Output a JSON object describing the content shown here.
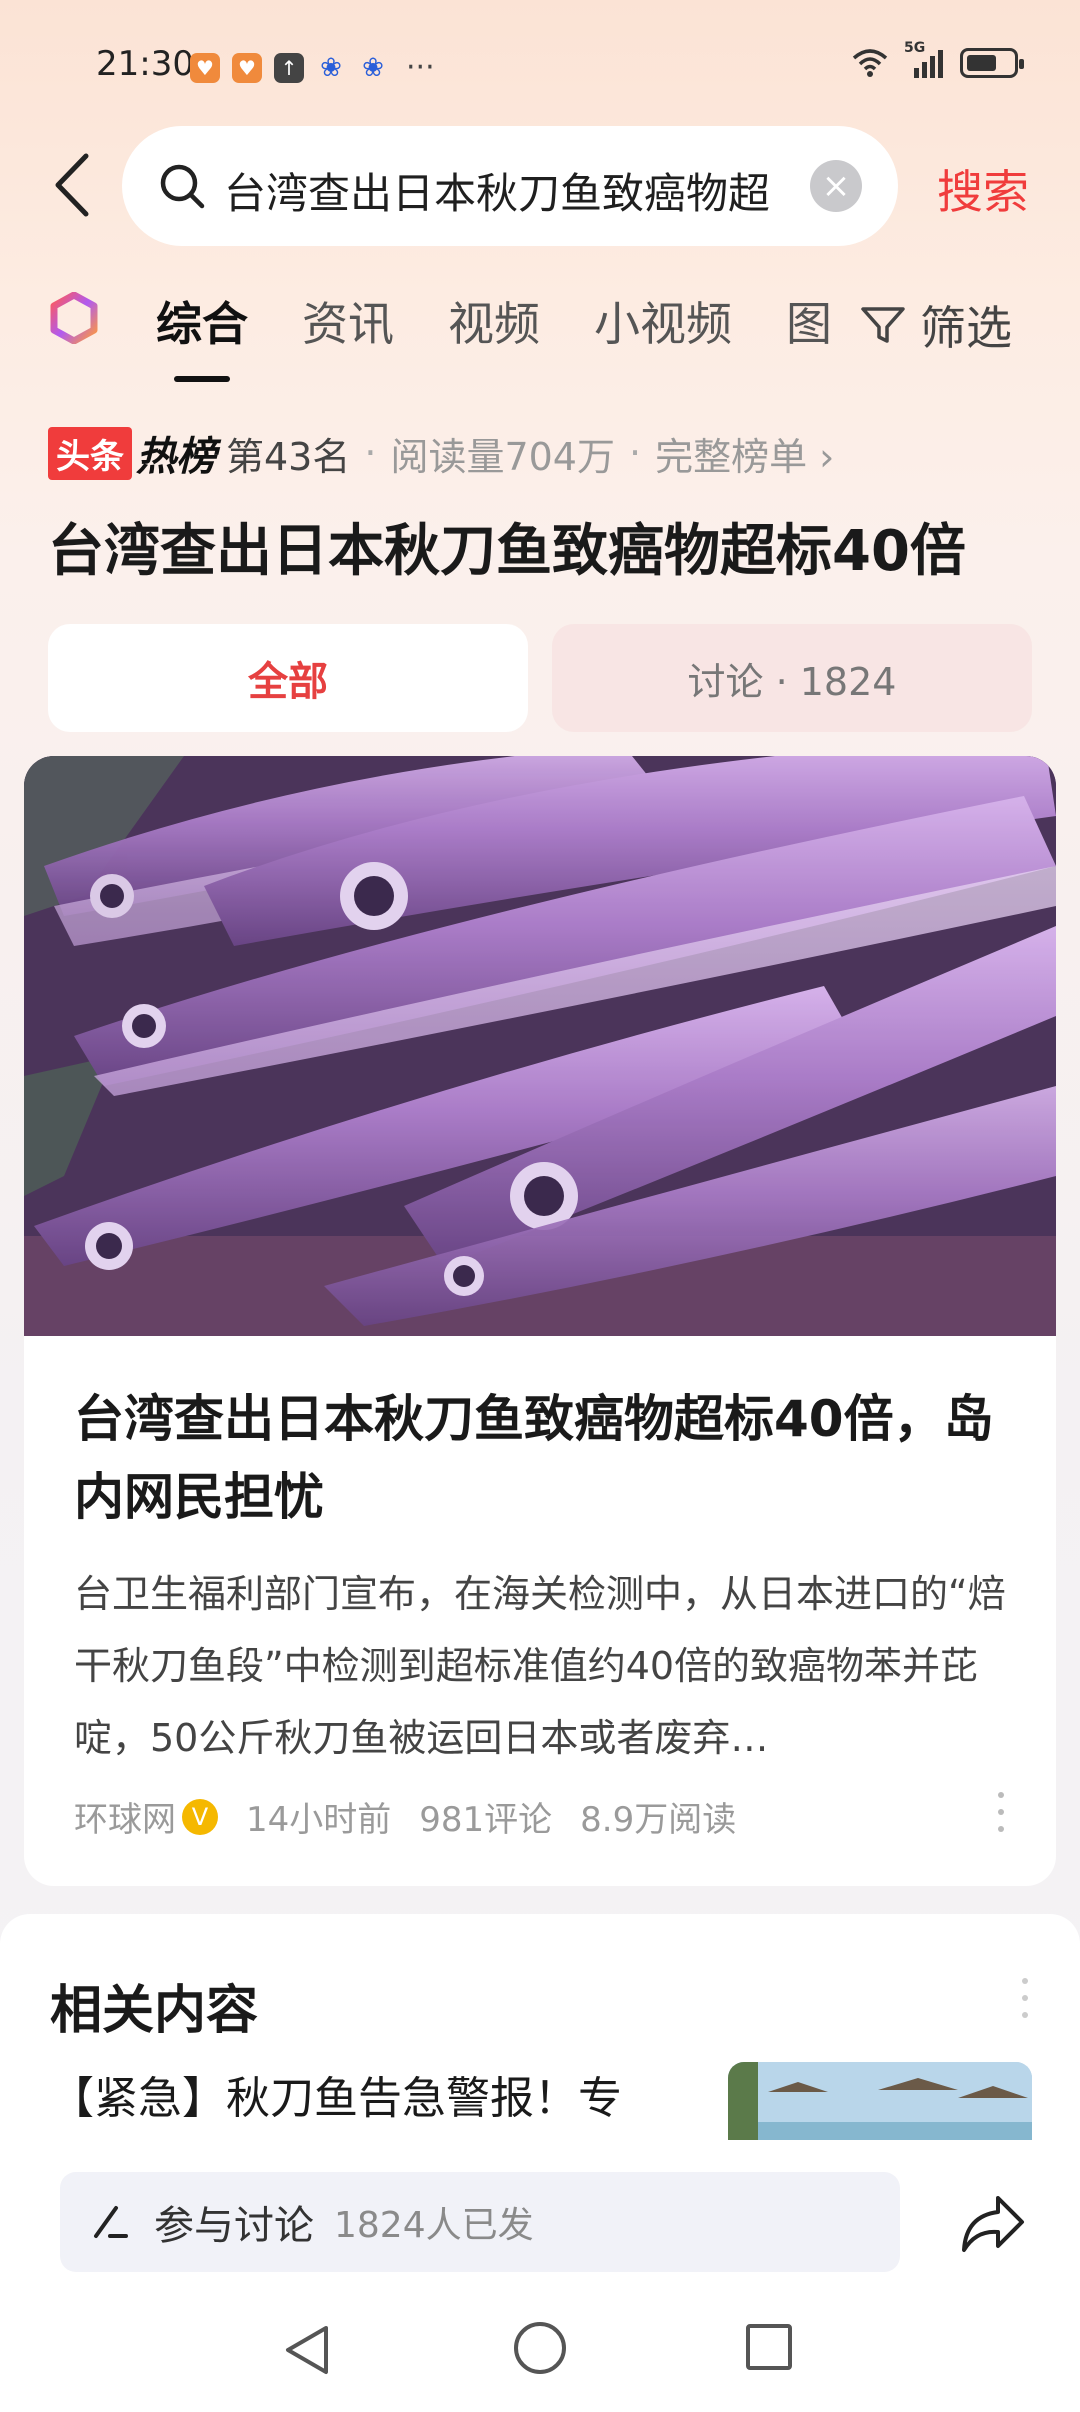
{
  "status_bar": {
    "time": "21:30",
    "signal_label": "5G",
    "battery_level": 0.65,
    "overflow": "···"
  },
  "search": {
    "query": "台湾查出日本秋刀鱼致癌物超",
    "submit_label": "搜索"
  },
  "tabs": [
    {
      "label": "综合",
      "active": true
    },
    {
      "label": "资讯",
      "active": false
    },
    {
      "label": "视频",
      "active": false
    },
    {
      "label": "小视频",
      "active": false
    },
    {
      "label": "图",
      "active": false
    }
  ],
  "filter_label": "筛选",
  "hot": {
    "brand": "头条",
    "badge": "热榜",
    "rank": "第43名",
    "reads": "阅读量704万",
    "full_list": "完整榜单 ›"
  },
  "headline": "台湾查出日本秋刀鱼致癌物超标40倍",
  "segments": {
    "all": "全部",
    "discussion": "讨论 · 1824"
  },
  "article": {
    "title": "台湾查出日本秋刀鱼致癌物超标40倍，岛内网民担忧",
    "summary": "台卫生福利部门宣布，在海关检测中，从日本进口的“焙干秋刀鱼段”中检测到超标准值约40倍的致癌物苯并芘啶，50公斤秋刀鱼被运回日本或者废弃…",
    "source": "环球网",
    "verified": "V",
    "time": "14小时前",
    "comments": "981评论",
    "reads": "8.9万阅读"
  },
  "related": {
    "title": "相关内容",
    "item_title": "【紧急】秋刀鱼告急警报！专"
  },
  "bottom": {
    "discuss_label": "参与讨论",
    "discuss_count": "1824人已发"
  },
  "colors": {
    "accent_red": "#f03c3c",
    "tab_active": "#111111"
  }
}
